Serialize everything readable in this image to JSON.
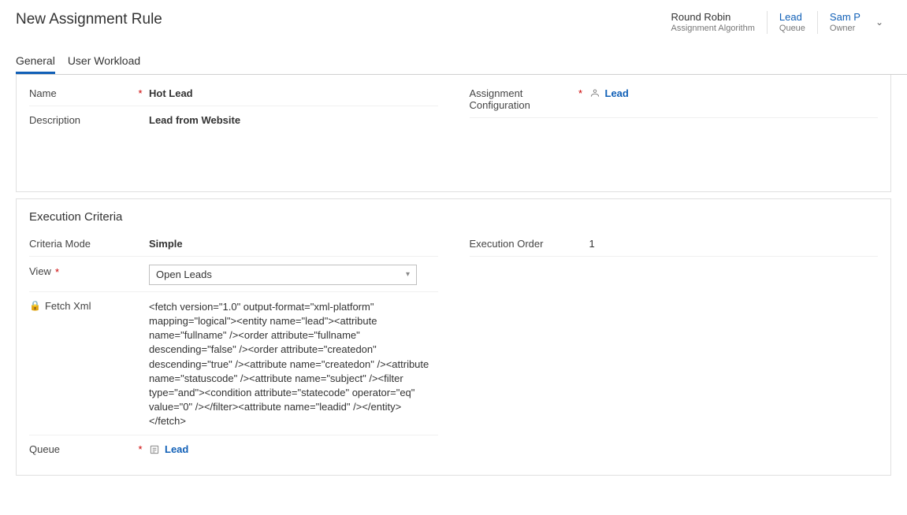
{
  "header": {
    "title": "New Assignment Rule",
    "summary": [
      {
        "value": "Round Robin",
        "label": "Assignment Algorithm",
        "link": false
      },
      {
        "value": "Lead",
        "label": "Queue",
        "link": true
      },
      {
        "value": "Sam P",
        "label": "Owner",
        "link": true
      }
    ]
  },
  "tabs": [
    {
      "label": "General",
      "active": true
    },
    {
      "label": "User Workload",
      "active": false
    }
  ],
  "general": {
    "fields": [
      {
        "label": "Name",
        "required": true,
        "value": "Hot Lead",
        "bold": true
      },
      {
        "label": "Description",
        "required": false,
        "value": "Lead from Website",
        "bold": true
      }
    ],
    "right": {
      "label": "Assignment Configuration",
      "required": true,
      "value": "Lead"
    }
  },
  "criteria": {
    "title": "Execution Criteria",
    "criteria_mode": {
      "label": "Criteria Mode",
      "value": "Simple",
      "bold": true
    },
    "view": {
      "label": "View",
      "required": true,
      "value": "Open Leads"
    },
    "fetchxml": {
      "label": "Fetch Xml",
      "value": "<fetch version=\"1.0\" output-format=\"xml-platform\" mapping=\"logical\"><entity name=\"lead\"><attribute name=\"fullname\" /><order attribute=\"fullname\" descending=\"false\" /><order attribute=\"createdon\" descending=\"true\" /><attribute name=\"createdon\" /><attribute name=\"statuscode\" /><attribute name=\"subject\" /><filter type=\"and\"><condition attribute=\"statecode\" operator=\"eq\" value=\"0\" /></filter><attribute name=\"leadid\" /></entity></fetch>"
    },
    "queue": {
      "label": "Queue",
      "required": true,
      "value": "Lead"
    },
    "execution_order": {
      "label": "Execution Order",
      "value": "1"
    }
  }
}
